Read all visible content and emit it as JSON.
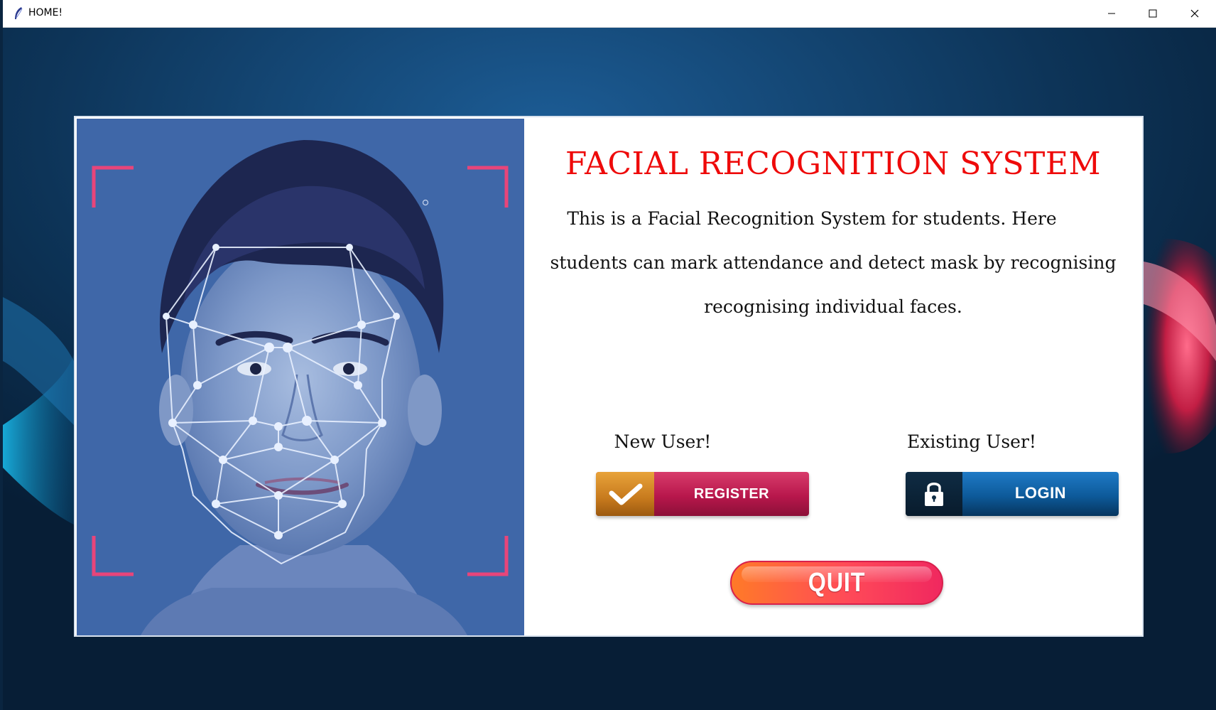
{
  "window": {
    "title": "HOME!",
    "icon": "feather-icon",
    "controls": [
      "minimize-icon",
      "maximize-icon",
      "close-icon"
    ]
  },
  "card": {
    "heading": "FACIAL RECOGNITION SYSTEM",
    "description_lines": [
      "This is a Facial Recognition System for students. Here",
      "students can mark attendance and detect mask by recognising",
      "recognising individual faces."
    ],
    "new_user_label": "New User!",
    "existing_user_label": "Existing User!",
    "register_label": "REGISTER",
    "login_label": "LOGIN",
    "quit_label": "QUIT"
  },
  "colors": {
    "heading": "#ee0a0a",
    "register": "#b8174c",
    "register_accent": "#e8a33a",
    "login": "#0d5a9a",
    "quit": "#ff4a58",
    "photo_bg": "#3f67a8",
    "frame_corners": "#e8457a"
  }
}
